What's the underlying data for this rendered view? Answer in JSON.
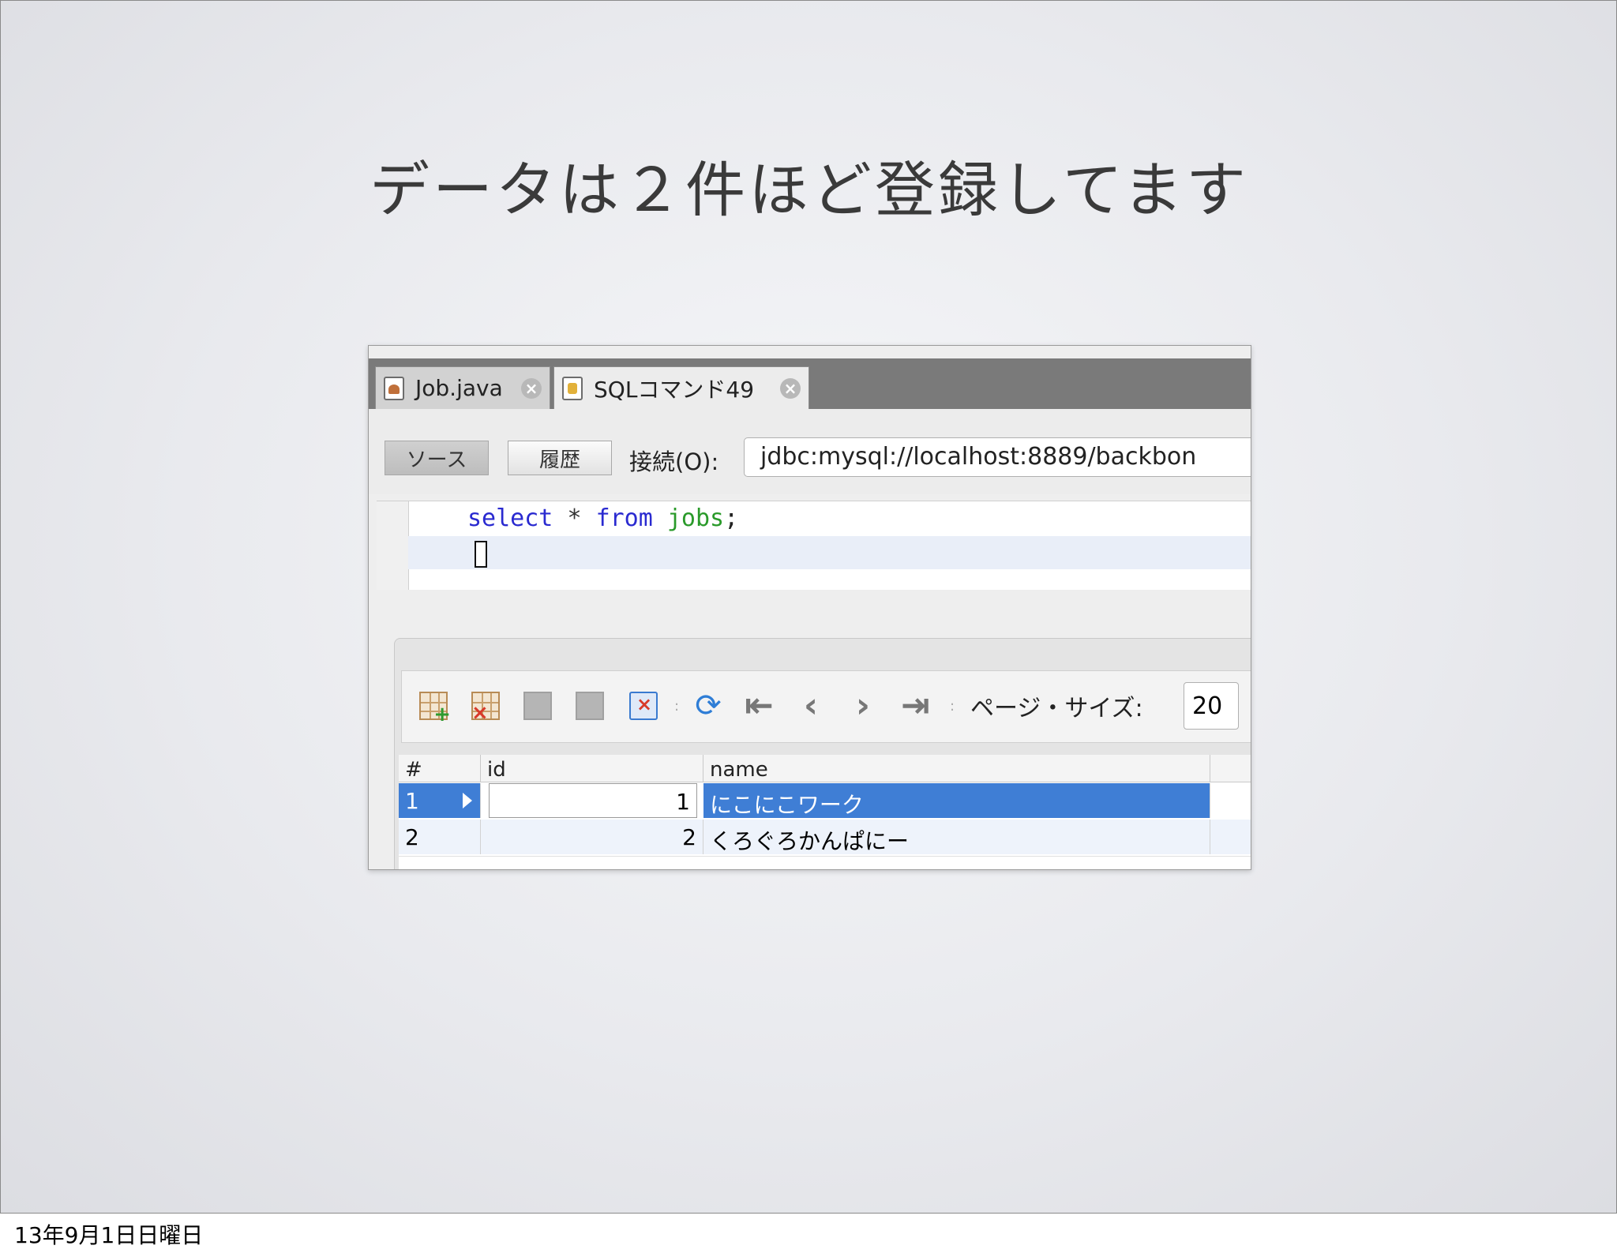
{
  "slide": {
    "title": "データは２件ほど登録してます",
    "footer_date": "13年9月1日日曜日"
  },
  "ide": {
    "tabs": [
      {
        "label": "Job.java",
        "icon": "java-file-icon"
      },
      {
        "label": "SQLコマンド49",
        "icon": "database-file-icon"
      }
    ],
    "toolbar": {
      "source_label": "ソース",
      "history_label": "履歴",
      "connection_label": "接続(O):",
      "connection_value": "jdbc:mysql://localhost:8889/backbon"
    },
    "editor": {
      "keyword_select": "select",
      "operator": "*",
      "keyword_from": "from",
      "table": "jobs",
      "terminator": ";"
    },
    "results": {
      "page_size_label": "ページ・サイズ:",
      "page_size_value": "20",
      "columns": [
        "#",
        "id",
        "name"
      ],
      "rows": [
        {
          "num": "1",
          "id": "1",
          "name": "にこにこワーク",
          "selected": true
        },
        {
          "num": "2",
          "id": "2",
          "name": "くろぐろかんぱにー",
          "selected": false
        }
      ]
    }
  },
  "colors": {
    "selection": "#3f7ed5",
    "keyword": "#2a2ad0",
    "identifier": "#2a9a2a"
  }
}
